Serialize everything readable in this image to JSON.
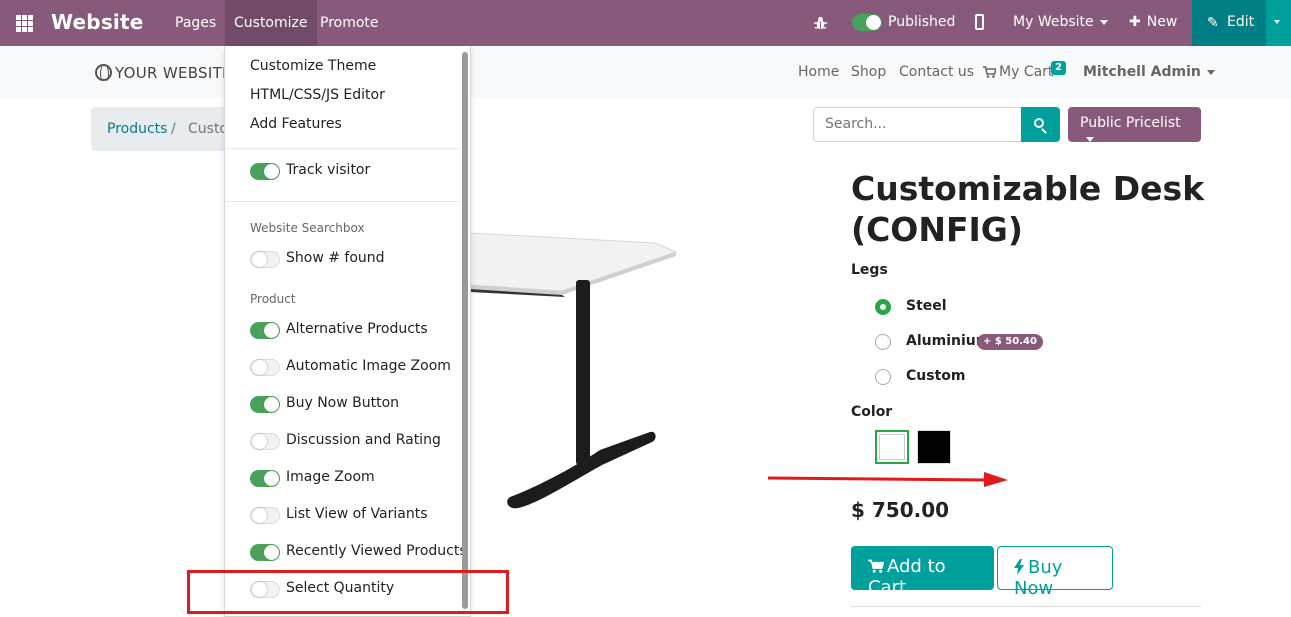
{
  "topbar": {
    "app_name": "Website",
    "menus": [
      "Pages",
      "Customize",
      "Promote"
    ],
    "published_label": "Published",
    "my_website_label": "My Website",
    "new_label": "New",
    "edit_label": "Edit"
  },
  "site_header": {
    "logo_text": "YOUR WEBSITE",
    "nav": [
      "Home",
      "Shop",
      "Contact us"
    ],
    "cart_label": "My Cart",
    "cart_count": "2",
    "user_name": "Mitchell Admin"
  },
  "breadcrumb": {
    "first": "Products",
    "separator": "/",
    "second": "Custo"
  },
  "search": {
    "placeholder": "Search..."
  },
  "pricelist": {
    "label": "Public Pricelist"
  },
  "product": {
    "title_line1": "Customizable Desk",
    "title_line2": "(CONFIG)",
    "legs_label": "Legs",
    "legs_options": [
      {
        "label": "Steel",
        "checked": true
      },
      {
        "label": "Aluminium",
        "checked": false,
        "extra": "+ $ 50.40"
      },
      {
        "label": "Custom",
        "checked": false
      }
    ],
    "color_label": "Color",
    "colors": [
      "#ffffff",
      "#000000"
    ],
    "price": "$ 750.00",
    "add_to_cart": "Add to Cart",
    "buy_now": "Buy Now"
  },
  "customize_menu": {
    "items": [
      "Customize Theme",
      "HTML/CSS/JS Editor",
      "Add Features"
    ],
    "track_visitor": {
      "label": "Track visitor",
      "on": true
    },
    "searchbox_header": "Website Searchbox",
    "show_found": {
      "label": "Show # found",
      "on": false
    },
    "product_header": "Product",
    "product_toggles": [
      {
        "label": "Alternative Products",
        "on": true
      },
      {
        "label": "Automatic Image Zoom",
        "on": false
      },
      {
        "label": "Buy Now Button",
        "on": true
      },
      {
        "label": "Discussion and Rating",
        "on": false
      },
      {
        "label": "Image Zoom",
        "on": true
      },
      {
        "label": "List View of Variants",
        "on": false
      },
      {
        "label": "Recently Viewed Products",
        "on": true
      },
      {
        "label": "Select Quantity",
        "on": false
      }
    ]
  },
  "colors": {
    "brand": "#875a7b",
    "brand_dark": "#714b67",
    "accent": "#00a09d",
    "toggle_on": "#49a15b",
    "annotation": "#e01b1b"
  }
}
